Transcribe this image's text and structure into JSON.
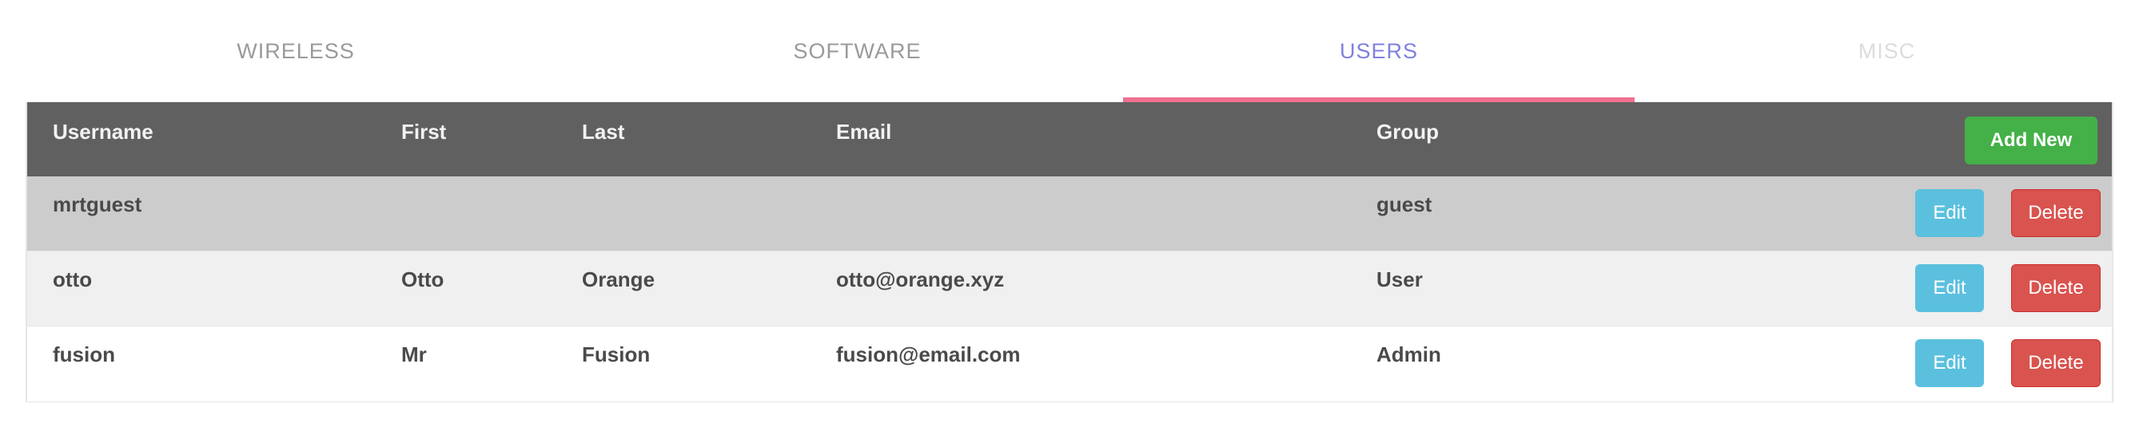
{
  "tabs": [
    {
      "label": "WIRELESS",
      "active": false
    },
    {
      "label": "SOFTWARE",
      "active": false
    },
    {
      "label": "USERS",
      "active": true
    },
    {
      "label": "MISC",
      "active": false
    }
  ],
  "colors": {
    "header_bg": "#606060",
    "add_button": "#44b048",
    "edit_button": "#5bc0de",
    "delete_button": "#d9534f",
    "active_tab_text": "#8080e0",
    "active_tab_underline": "#f07090"
  },
  "table": {
    "columns": [
      "Username",
      "First",
      "Last",
      "Email",
      "Group"
    ],
    "add_button_label": "Add New",
    "rows": [
      {
        "username": "mrtguest",
        "first": "",
        "last": "",
        "email": "",
        "group": "guest",
        "edit_label": "Edit",
        "delete_label": "Delete"
      },
      {
        "username": "otto",
        "first": "Otto",
        "last": "Orange",
        "email": "otto@orange.xyz",
        "group": "User",
        "edit_label": "Edit",
        "delete_label": "Delete"
      },
      {
        "username": "fusion",
        "first": "Mr",
        "last": "Fusion",
        "email": "fusion@email.com",
        "group": "Admin",
        "edit_label": "Edit",
        "delete_label": "Delete"
      }
    ]
  }
}
